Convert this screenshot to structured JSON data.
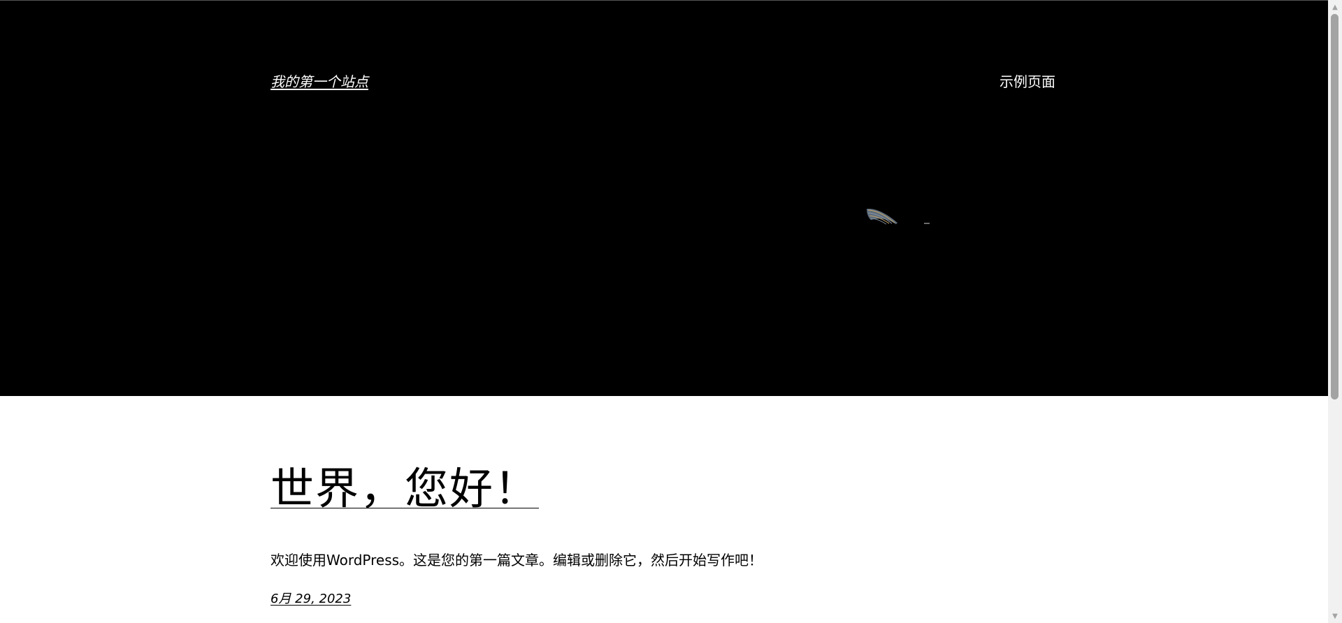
{
  "header": {
    "site_title": "我的第一个站点",
    "nav": [
      {
        "label": "示例页面"
      }
    ]
  },
  "post": {
    "title": "世界，您好！",
    "excerpt": "欢迎使用WordPress。这是您的第一篇文章。编辑或删除它，然后开始写作吧！",
    "date": "6月 29, 2023"
  },
  "colors": {
    "hero_background": "#000000",
    "page_background": "#ffffff",
    "text_on_dark": "#ffffff",
    "text_on_light": "#000000"
  },
  "icons": {
    "scroll_up": "scroll-up-arrow-icon",
    "scroll_down": "scroll-down-arrow-icon"
  }
}
